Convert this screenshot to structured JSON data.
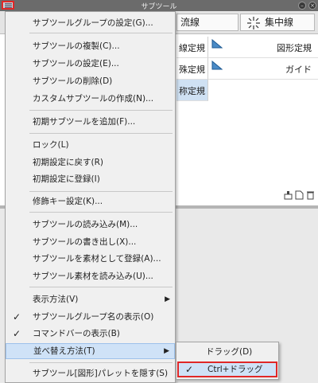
{
  "window": {
    "title": "サブツール"
  },
  "tabs": [
    "流線",
    "集中線"
  ],
  "tools": {
    "left": [
      "線定規",
      "殊定規",
      "称定規"
    ],
    "right": [
      "図形定規",
      "ガイド"
    ]
  },
  "menu": {
    "items": [
      {
        "label": "サブツールグループの設定(G)..."
      },
      {
        "label": "サブツールの複製(C)..."
      },
      {
        "label": "サブツールの設定(E)..."
      },
      {
        "label": "サブツールの削除(D)"
      },
      {
        "label": "カスタムサブツールの作成(N)..."
      },
      {
        "label": "初期サブツールを追加(F)..."
      },
      {
        "label": "ロック(L)"
      },
      {
        "label": "初期設定に戻す(R)"
      },
      {
        "label": "初期設定に登録(I)"
      },
      {
        "label": "修飾キー設定(K)..."
      },
      {
        "label": "サブツールの読み込み(M)..."
      },
      {
        "label": "サブツールの書き出し(X)..."
      },
      {
        "label": "サブツールを素材として登録(A)..."
      },
      {
        "label": "サブツール素材を読み込み(U)..."
      },
      {
        "label": "表示方法(V)"
      },
      {
        "label": "サブツールグループ名の表示(O)"
      },
      {
        "label": "コマンドバーの表示(B)"
      },
      {
        "label": "並べ替え方法(T)"
      },
      {
        "label": "サブツール[図形]パレットを隠す(S)"
      }
    ]
  },
  "submenu": {
    "items": [
      {
        "label": "ドラッグ(D)"
      },
      {
        "label": "Ctrl+ドラッグ"
      }
    ]
  },
  "marks": {
    "check": "✓",
    "arrow": "▶"
  },
  "colors": {
    "highlight": "#cfe2f7",
    "callout": "#e02828"
  }
}
